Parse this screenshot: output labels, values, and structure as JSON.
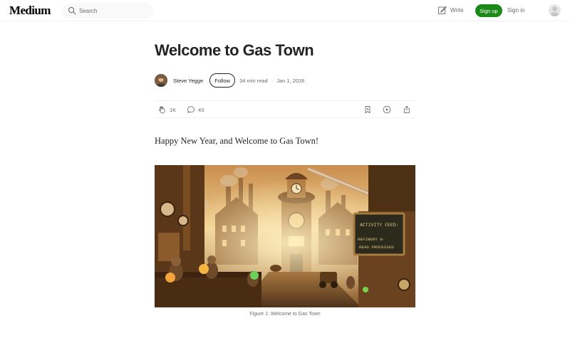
{
  "header": {
    "logo": "Medium",
    "search_placeholder": "Search",
    "write_label": "Write",
    "signup_label": "Sign up",
    "signin_label": "Sign in"
  },
  "article": {
    "title": "Welcome to Gas Town",
    "author": "Steve Yegge",
    "follow_label": "Follow",
    "read_time": "34 min read",
    "date": "Jan 1, 2026",
    "claps": "1K",
    "responses": "43",
    "lead": "Happy New Year, and Welcome to Gas Town!",
    "figure": {
      "sign_line1": "ACTIVITY FEED:",
      "sign_line2": "REFINERY 8-",
      "sign_line3": "READ PROCESSED",
      "caption": "Figure 1: Welcome to Gas Town"
    }
  },
  "colors": {
    "accent_green": "#1a8917",
    "text": "#242424",
    "muted": "#6b6b6b"
  },
  "icons": [
    "search-icon",
    "write-icon",
    "user-icon",
    "clap-icon",
    "comment-icon",
    "bookmark-icon",
    "play-icon",
    "share-icon"
  ]
}
